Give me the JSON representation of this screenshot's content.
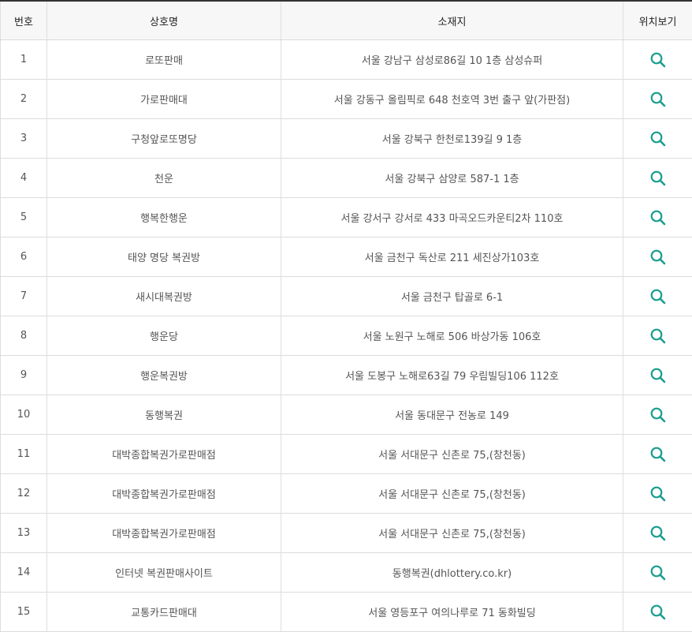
{
  "table": {
    "headers": {
      "number": "번호",
      "name": "상호명",
      "address": "소재지",
      "location": "위치보기"
    },
    "rows": [
      {
        "number": "1",
        "name": "로또판매",
        "address": "서울 강남구 삼성로86길 10 1층 삼성슈퍼"
      },
      {
        "number": "2",
        "name": "가로판매대",
        "address": "서울 강동구 올림픽로 648 천호역 3번 출구 앞(가판점)"
      },
      {
        "number": "3",
        "name": "구청앞로또명당",
        "address": "서울 강북구 한천로139길 9 1층"
      },
      {
        "number": "4",
        "name": "천운",
        "address": "서울 강북구 삼양로 587-1 1층"
      },
      {
        "number": "5",
        "name": "행복한행운",
        "address": "서울 강서구 강서로 433 마곡오드카운티2차 110호"
      },
      {
        "number": "6",
        "name": "태양 명당 복권방",
        "address": "서울 금천구 독산로 211 세진상가103호"
      },
      {
        "number": "7",
        "name": "새시대복권방",
        "address": "서울 금천구 탑골로 6-1"
      },
      {
        "number": "8",
        "name": "행운당",
        "address": "서울 노원구 노해로 506 바상가동 106호"
      },
      {
        "number": "9",
        "name": "행운복권방",
        "address": "서울 도봉구 노해로63길 79 우림빌딩106 112호"
      },
      {
        "number": "10",
        "name": "동행복권",
        "address": "서울 동대문구 전농로 149"
      },
      {
        "number": "11",
        "name": "대박종합복권가로판매점",
        "address": "서울 서대문구 신촌로 75,(창천동)"
      },
      {
        "number": "12",
        "name": "대박종합복권가로판매점",
        "address": "서울 서대문구 신촌로 75,(창천동)"
      },
      {
        "number": "13",
        "name": "대박종합복권가로판매점",
        "address": "서울 서대문구 신촌로 75,(창천동)"
      },
      {
        "number": "14",
        "name": "인터넷 복권판매사이트",
        "address": "동행복권(dhlottery.co.kr)"
      },
      {
        "number": "15",
        "name": "교통카드판매대",
        "address": "서울 영등포구 여의나루로 71 동화빌딩"
      }
    ]
  },
  "icons": {
    "location": "search-icon"
  },
  "colors": {
    "accent": "#1a9e8f",
    "header_bg": "#f7f7f7",
    "top_border": "#333333"
  }
}
